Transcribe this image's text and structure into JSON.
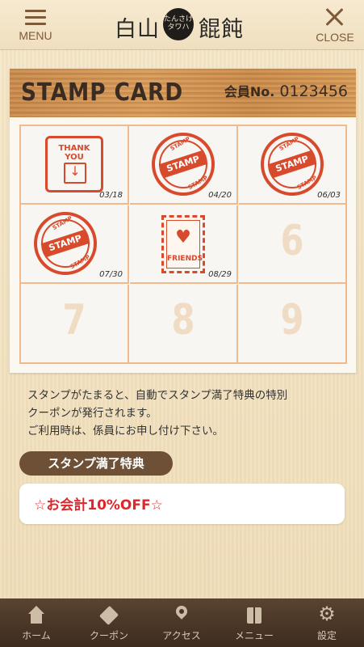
{
  "header": {
    "menu_label": "MENU",
    "close_label": "CLOSE",
    "logo_left": "白山",
    "logo_seal": "たんさけ タワハ",
    "logo_right": "餛飩"
  },
  "card": {
    "title": "STAMP CARD",
    "member_label": "会員No.",
    "member_no": "0123456",
    "cells": [
      {
        "type": "thankyou",
        "label": "THANK YOU",
        "date": "03/18"
      },
      {
        "type": "stamp",
        "label": "STAMP",
        "date": "04/20"
      },
      {
        "type": "stamp",
        "label": "STAMP",
        "date": "06/03"
      },
      {
        "type": "stamp",
        "label": "STAMP",
        "date": "07/30"
      },
      {
        "type": "friends",
        "label": "FRIENDS",
        "date": "08/29"
      },
      {
        "type": "empty",
        "num": "6"
      },
      {
        "type": "empty",
        "num": "7"
      },
      {
        "type": "empty",
        "num": "8"
      },
      {
        "type": "empty",
        "num": "9"
      }
    ]
  },
  "notice": {
    "line1": "スタンプがたまると、自動でスタンプ満了特典の特別",
    "line2": "クーポンが発行されます。",
    "line3": "ご利用時は、係員にお申し付け下さい。"
  },
  "benefit": {
    "tag": "スタンプ満了特典",
    "text": "☆お会計10%OFF☆"
  },
  "tabs": [
    {
      "label": "ホーム",
      "icon": "home-icon"
    },
    {
      "label": "クーポン",
      "icon": "tag-icon"
    },
    {
      "label": "アクセス",
      "icon": "map-pin-icon"
    },
    {
      "label": "メニュー",
      "icon": "book-icon"
    },
    {
      "label": "設定",
      "icon": "gear-icon"
    }
  ],
  "colors": {
    "accent": "#d84a2c",
    "tabbar": "#4a3626",
    "benefit_text": "#e0262b"
  }
}
